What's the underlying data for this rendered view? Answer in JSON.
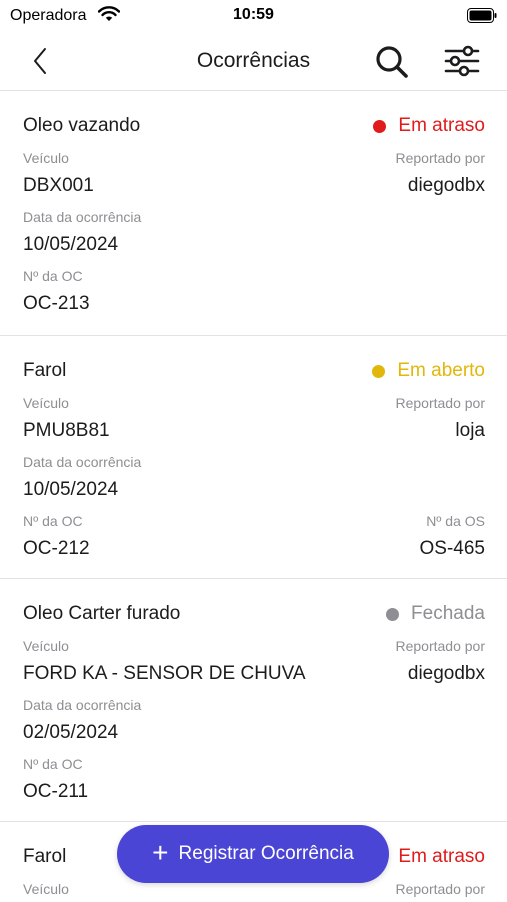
{
  "status_bar": {
    "carrier": "Operadora",
    "time": "10:59"
  },
  "nav": {
    "title": "Ocorrências"
  },
  "labels": {
    "vehicle": "Veículo",
    "reported_by": "Reportado por",
    "date": "Data da ocorrência",
    "oc_number": "Nº da OC",
    "os_number": "Nº da OS"
  },
  "colors": {
    "late": "#e01b1b",
    "open": "#e2b70c",
    "closed": "#8e8e93",
    "accent": "#4b45d6"
  },
  "occurrences": [
    {
      "title": "Oleo vazando",
      "status": "Em atraso",
      "vehicle": "DBX001",
      "reported_by": "diegodbx",
      "date": "10/05/2024",
      "oc": "OC-213"
    },
    {
      "title": "Farol",
      "status": "Em aberto",
      "vehicle": "PMU8B81",
      "reported_by": "loja",
      "date": "10/05/2024",
      "oc": "OC-212",
      "os": "OS-465"
    },
    {
      "title": "Oleo Carter furado",
      "status": "Fechada",
      "vehicle": "FORD KA - SENSOR DE CHUVA",
      "reported_by": "diegodbx",
      "date": "02/05/2024",
      "oc": "OC-211"
    },
    {
      "title": "Farol",
      "status": "Em atraso"
    }
  ],
  "fab": {
    "label": "Registrar Ocorrência"
  }
}
